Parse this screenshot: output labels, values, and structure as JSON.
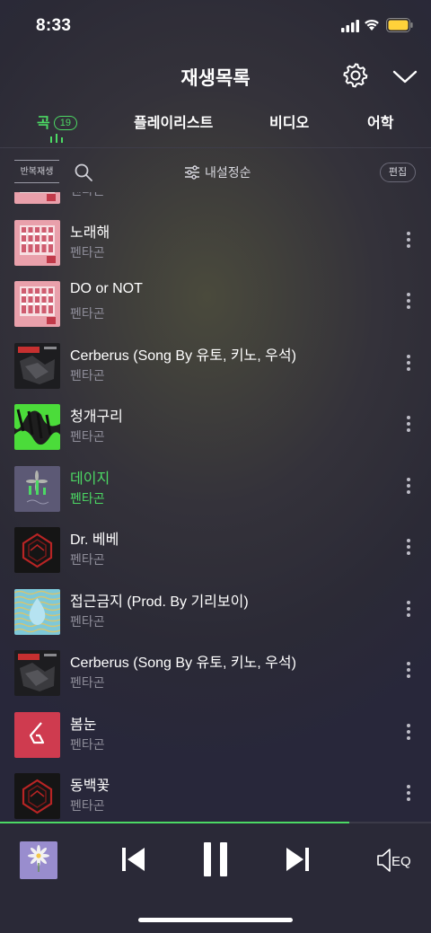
{
  "status_bar": {
    "time": "8:33"
  },
  "header": {
    "title": "재생목록"
  },
  "tabs": [
    {
      "label": "곡",
      "count": "19"
    },
    {
      "label": "플레이리스트"
    },
    {
      "label": "비디오"
    },
    {
      "label": "어학"
    }
  ],
  "toolbar": {
    "repeat_label": "반복재생",
    "sort_label": "내설정순",
    "edit_label": "편집"
  },
  "songs": [
    {
      "title": "",
      "artist": "펜타곤",
      "art": "pink"
    },
    {
      "title": "노래해",
      "artist": "펜타곤",
      "art": "pink"
    },
    {
      "title": "DO or NOT",
      "artist": "펜타곤",
      "art": "pink"
    },
    {
      "title": "Cerberus (Song By 유토, 키노, 우석)",
      "artist": "펜타곤",
      "art": "dark"
    },
    {
      "title": "청개구리",
      "artist": "펜타곤",
      "art": "green"
    },
    {
      "title": "데이지",
      "artist": "펜타곤",
      "art": "daisy",
      "playing": true
    },
    {
      "title": "Dr. 베베",
      "artist": "펜타곤",
      "art": "redgeo"
    },
    {
      "title": "접근금지 (Prod. By 기리보이)",
      "artist": "펜타곤",
      "art": "blue"
    },
    {
      "title": "Cerberus (Song By 유토, 키노, 우석)",
      "artist": "펜타곤",
      "art": "dark"
    },
    {
      "title": "봄눈",
      "artist": "펜타곤",
      "art": "redlogo"
    },
    {
      "title": "동백꽃",
      "artist": "펜타곤",
      "art": "redgeo"
    }
  ],
  "player": {
    "progress": 0.81,
    "eq_label": "EQ"
  },
  "colors": {
    "accent": "#4cd964",
    "background": "#2b2a36"
  }
}
